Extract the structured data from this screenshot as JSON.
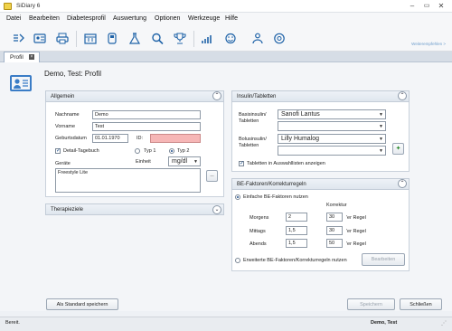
{
  "window": {
    "title": "SiDiary 6"
  },
  "menu": [
    "Datei",
    "Bearbeiten",
    "Diabetesprofil",
    "Auswertung",
    "Optionen",
    "Werkzeuge",
    "Hilfe"
  ],
  "toolbar": {
    "icons": [
      "new-entry-icon",
      "id-card-icon",
      "print-icon",
      "calendar-icon",
      "device-icon",
      "flask-icon",
      "search-icon",
      "trophy-icon",
      "chart-icon",
      "smiley-icon",
      "people-icon",
      "help-icon"
    ],
    "right_link": "Weiterempfehlen >"
  },
  "tab": {
    "label": "Profil",
    "close": "×"
  },
  "profile": {
    "header": "Demo, Test: Profil"
  },
  "allgemein": {
    "title": "Allgemein",
    "nachname_label": "Nachname",
    "nachname_value": "Demo",
    "vorname_label": "Vorname",
    "vorname_value": "Test",
    "geburtsdatum_label": "Geburtsdatum",
    "geburtsdatum_value": "01.01.1970",
    "id_label": "ID:",
    "id_value": "",
    "detail_tagebuch_label": "Detail-Tagebuch",
    "typ1_label": "Typ 1",
    "typ2_label": "Typ 2",
    "einheit_label": "Einheit",
    "einheit_value": "mg/dl",
    "geraete_label": "Geräte",
    "geraete_value": "Freestyle Lite",
    "more_button": "..."
  },
  "therapieziele": {
    "title": "Therapieziele"
  },
  "insulin": {
    "title": "Insulin/Tabletten",
    "basis_label": "Basisinsulin/ Tabletten",
    "basis_value": "Sanofi Lantus",
    "bolus_label": "Bolusinsulin/ Tabletten",
    "bolus_value": "Lilly Humalog",
    "show_tablets_label": "Tabletten in Auswahllisten anzeigen"
  },
  "be": {
    "title": "BE-Faktoren/Korrekturregeln",
    "simple_label": "Einfache BE-Faktoren nutzen",
    "korrektur_label": "Korrektur",
    "rows": [
      {
        "label": "Morgens",
        "factor": "2",
        "korr": "30",
        "suffix": "'er Regel"
      },
      {
        "label": "Mittags",
        "factor": "1,5",
        "korr": "30",
        "suffix": "'er Regel"
      },
      {
        "label": "Abends",
        "factor": "1,5",
        "korr": "50",
        "suffix": "'er Regel"
      }
    ],
    "extended_label": "Erweiterte BE-Faktoren/Korrekturregeln nutzen",
    "edit_button": "Bearbeiten"
  },
  "actions": {
    "standard": "Als Standard speichern",
    "save": "Speichern",
    "close": "Schließen"
  },
  "status": {
    "left": "Bereit.",
    "right": "Demo, Test"
  }
}
